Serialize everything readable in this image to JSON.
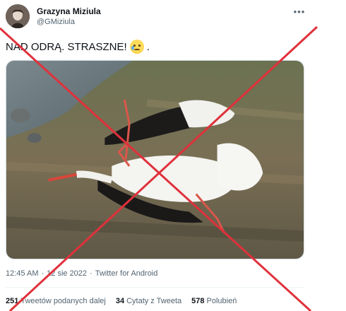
{
  "tweet": {
    "display_name": "Grazyna Miziula",
    "handle": "@GMiziula",
    "more_icon": "more-horizontal-icon",
    "text": "NAD ODRĄ. STRASZNE!",
    "text_suffix": ".",
    "emoji": "sad-tear-face-emoji",
    "image_alt": "dead white stork lying on grassy riverbank"
  },
  "meta": {
    "time": "12:45 AM",
    "separator1": "·",
    "date": "12 sie 2022",
    "separator2": "·",
    "source": "Twitter for Android"
  },
  "stats": {
    "retweets_count": "251",
    "retweets_label": "Tweetów podanych dalej",
    "quotes_count": "34",
    "quotes_label": "Cytaty z Tweeta",
    "likes_count": "578",
    "likes_label": "Polubień"
  },
  "overlay": {
    "cross_color": "#e0313b"
  },
  "colors": {
    "text_primary": "#0f1419",
    "text_secondary": "#536471",
    "divider": "#eff3f4"
  }
}
